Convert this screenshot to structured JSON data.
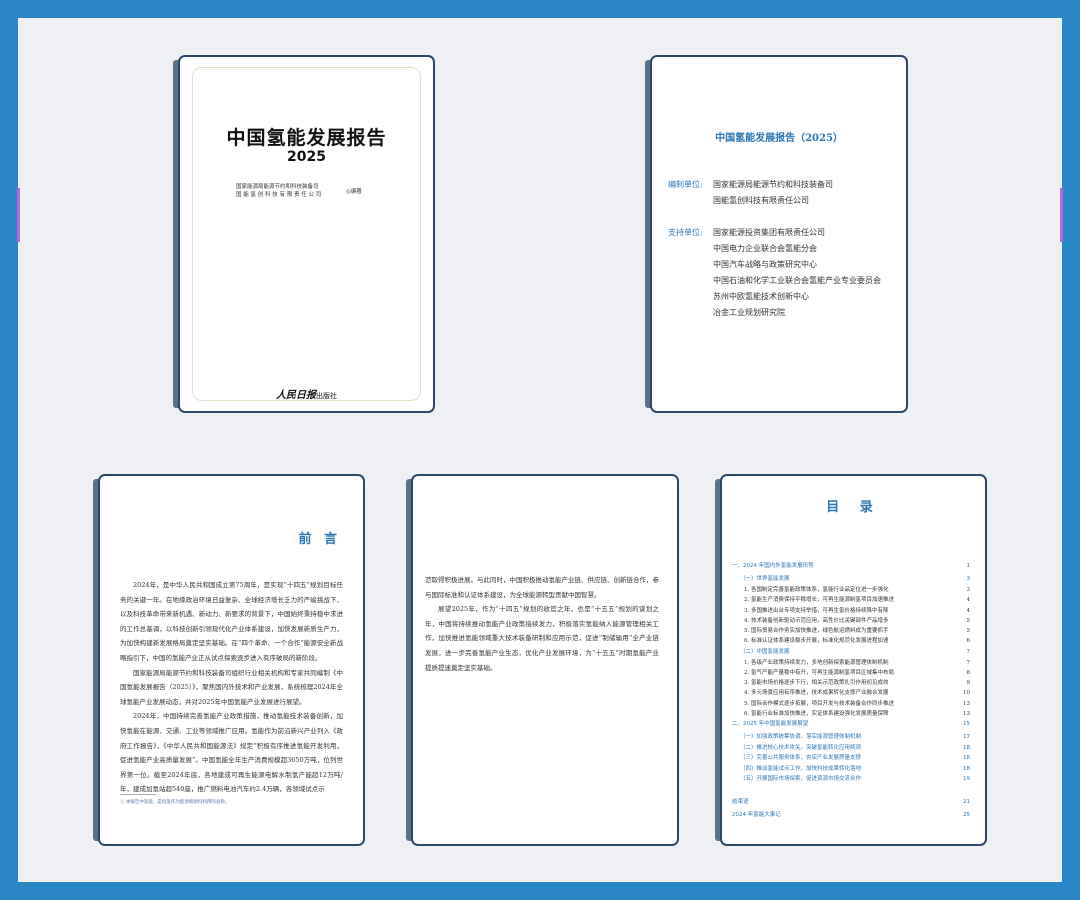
{
  "cover": {
    "title": "中国氢能发展报告",
    "year": "2025",
    "org_line1": "国家能源局能源节约和科技装备司",
    "org_line2": "国 能 氢 创 科 技 有 限 责 任 公 司",
    "edit_mark": "◎编著",
    "publisher_logo": "人民日报",
    "publisher_suffix": "出版社"
  },
  "credits": {
    "title": "中国氢能发展报告（2025）",
    "compiler_label": "编制单位:",
    "compilers": [
      "国家能源局能源节约和科技装备司",
      "国能氢创科技有限责任公司"
    ],
    "supporter_label": "支持单位:",
    "supporters": [
      "国家能源投资集团有限责任公司",
      "中国电力企业联合会氢能分会",
      "中国汽车战略与政策研究中心",
      "中国石油和化学工业联合会氢能产业专业委员会",
      "苏州中欧氢能技术创新中心",
      "冶金工业规划研究院"
    ]
  },
  "preface": {
    "title": "前 言",
    "paragraphs": [
      "2024年，是中华人民共和国成立第75周年，是实现“十四五”规划目标任务的关键一年。在地缘政治环境日益复杂、全球经济增长乏力的严峻挑战下，以及科技革命带来新机遇、新动力、新要求的背景下，中国始终秉持稳中求进的工作总基调，以科技创新引领现代化产业体系建设，加快发展新质生产力，为加快构建新发展格局奠定坚实基础。在“四个革命、一个合作”能源安全新战略指引下，中国的氢能产业正从试点探索逐步进入有序破局的新阶段。",
      "国家能源局能源节约和科技装备司组织行业相关机构和专家共同编制《中国氢能发展报告（2025）》，聚焦国内外技术和产业发展，系统梳理2024年全球氢能产业发展动态，并对2025年中国氢能产业发展进行展望。",
      "2024年，中国持续完善氢能产业政策措施，推动氢能技术装备创新，加快氢能在能源、交通、工业等领域推广应用。氢能作为前沿新兴产业列入《政府工作报告》，《中华人民共和国能源法》规定“积极有序推进氢能开发利用，促进氢能产业高质量发展”。中国氢能全年生产消费规模超3650万吨，位列世界第一位。截至2024年底，各地建成可再生能源电解水制氢产能超12万吨/年，建成加氢站超540座，推广燃料电池汽车约2.4万辆，各领域试点示"
    ],
    "footnote": "① 本报告中氢能，是指氢作为能源和燃料利用的总称。"
  },
  "continuation": {
    "paragraphs": [
      "范取得积极进展。与此同时，中国积极推动氢能产业链、供应链、创新链合作，参与国际标准和认证体系建设，为全球能源转型贡献中国智慧。",
      "展望2025年，作为“十四五”规划的收官之年，也是“十五五”规划的谋划之年，中国将持续推动氢能产业政策接续发力，积极落实氢能纳入能源管理相关工作，加快推进氢能领域重大技术装备研制和应用示范，促进“制储输用”全产业链发展，进一步完善氢能产业生态，优化产业发展环境，为“十五五”时期氢能产业提质提速奠定坚实基础。"
    ]
  },
  "contents": {
    "title": "目 录",
    "entries": [
      {
        "level": 1,
        "text": "一、2024 年国内外氢能发展形势",
        "page": "1"
      },
      {
        "level": 2,
        "text": "（一）世界氢能发展",
        "page": "3"
      },
      {
        "level": 3,
        "text": "1. 各国制定完善氢能政策体系，氢能行业品定位进一步强化",
        "page": "3"
      },
      {
        "level": 3,
        "text": "2. 氢能生产消费保持平稳增长，可再生能源制氢项目加速推进",
        "page": "4"
      },
      {
        "level": 3,
        "text": "3. 多国推进出台专项支持举措，可再生氢价格持续降中有降",
        "page": "4"
      },
      {
        "level": 3,
        "text": "4. 技术装备创新驱动示范应用，高性价比关键部件产品增多",
        "page": "5"
      },
      {
        "level": 3,
        "text": "5. 国际贸易合作务实加快推进，绿色航运燃料成为重要抓手",
        "page": "5"
      },
      {
        "level": 3,
        "text": "6. 标准认证体系建设稳步开展，标准化规范化发展进程加速",
        "page": "6"
      },
      {
        "level": 2,
        "text": "（二）中国氢能发展",
        "page": "7"
      },
      {
        "level": 3,
        "text": "1. 各级产业政策持续发力，多地创新探索能源管理体制机制",
        "page": "7"
      },
      {
        "level": 3,
        "text": "2. 氢气产能产量稳中有升，可再生能源制氢项目区域集中布局",
        "page": "8"
      },
      {
        "level": 3,
        "text": "3. 氢能市场价格逐步下行，相关示范政策扎引作用初见成效",
        "page": "9"
      },
      {
        "level": 3,
        "text": "4. 多元场景应用有序推进，技术成果转化支撑产业融合发展",
        "page": "10"
      },
      {
        "level": 3,
        "text": "5. 国际合作模式逐步拓展，项目开发与技术装备合作同步推进",
        "page": "13"
      },
      {
        "level": 3,
        "text": "6. 氢能行业标准加快推进，实证体系建设强化发展质量保障",
        "page": "13"
      },
      {
        "level": 1,
        "text": "二、2025 年中国氢能发展展望",
        "page": "15"
      },
      {
        "level": 2,
        "text": "（一）加强政策统筹协调，落实能源管理体制机制",
        "page": "17"
      },
      {
        "level": 2,
        "text": "（二）推进核心技术攻关，突破氢能转化应用瓶颈",
        "page": "18"
      },
      {
        "level": 2,
        "text": "（三）完善公共服务体系，夯实产业发展质量支撑",
        "page": "18"
      },
      {
        "level": 2,
        "text": "（四）推动氢能试点工作，加快科技成果转化落地",
        "page": "18"
      },
      {
        "level": 2,
        "text": "（五）开展国际市场探索，促进资源市场交流合作",
        "page": "19"
      },
      {
        "level": 1,
        "text": "结束语",
        "page": "21"
      },
      {
        "level": 1,
        "text": "2024 年氢能大事记",
        "page": "25"
      }
    ]
  }
}
